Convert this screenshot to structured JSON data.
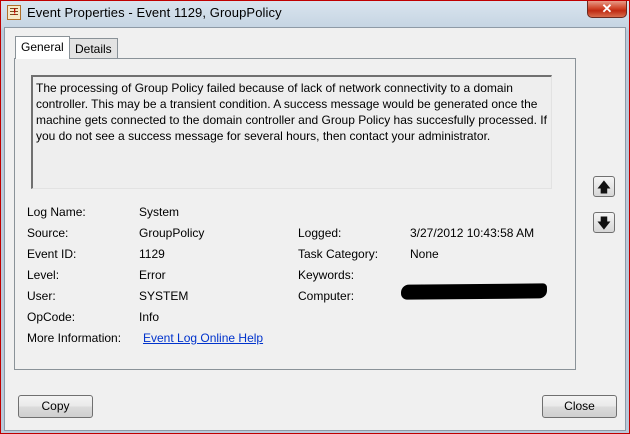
{
  "window": {
    "title": "Event Properties - Event 1129, GroupPolicy",
    "title_icon": "event-viewer-icon",
    "close_glyph": "✕"
  },
  "tabs": [
    {
      "label": "General",
      "active": true
    },
    {
      "label": "Details",
      "active": false
    }
  ],
  "description": "The processing of Group Policy failed because of lack of network connectivity to a domain controller. This may be a transient condition. A success message would be generated once the machine gets connected to the domain controller and Group Policy has succesfully processed. If you do not see a success message for several hours, then contact your administrator.",
  "fields": {
    "log_name": {
      "label": "Log Name:",
      "value": "System"
    },
    "source": {
      "label": "Source:",
      "value": "GroupPolicy"
    },
    "event_id": {
      "label": "Event ID:",
      "value": "1129"
    },
    "level": {
      "label": "Level:",
      "value": "Error"
    },
    "user": {
      "label": "User:",
      "value": "SYSTEM"
    },
    "opcode": {
      "label": "OpCode:",
      "value": "Info"
    },
    "more_info": {
      "label": "More Information:",
      "value": "Event Log Online Help"
    },
    "logged": {
      "label": "Logged:",
      "value": "3/27/2012 10:43:58 AM"
    },
    "task_category": {
      "label": "Task Category:",
      "value": "None"
    },
    "keywords": {
      "label": "Keywords:",
      "value": ""
    },
    "computer": {
      "label": "Computer:",
      "value": ""
    }
  },
  "nav": {
    "up_glyph": "🡅",
    "down_glyph": "🡇"
  },
  "buttons": {
    "copy": "Copy",
    "close": "Close"
  },
  "colors": {
    "link": "#0033cc",
    "frame_border": "#c00000",
    "close_button": "#c8351b"
  }
}
